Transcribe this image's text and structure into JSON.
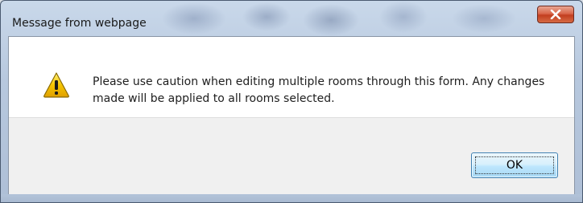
{
  "window": {
    "title": "Message from webpage"
  },
  "message": {
    "text": "Please use caution when editing multiple rooms through this form. Any changes made will be applied to all rooms selected.",
    "icon": "warning-icon"
  },
  "buttons": {
    "ok_label": "OK"
  },
  "colors": {
    "close_button": "#c94a2d",
    "ok_button_border": "#3c7fb1",
    "button_area_bg": "#f0f0f0",
    "warning_yellow": "#f5c400"
  }
}
